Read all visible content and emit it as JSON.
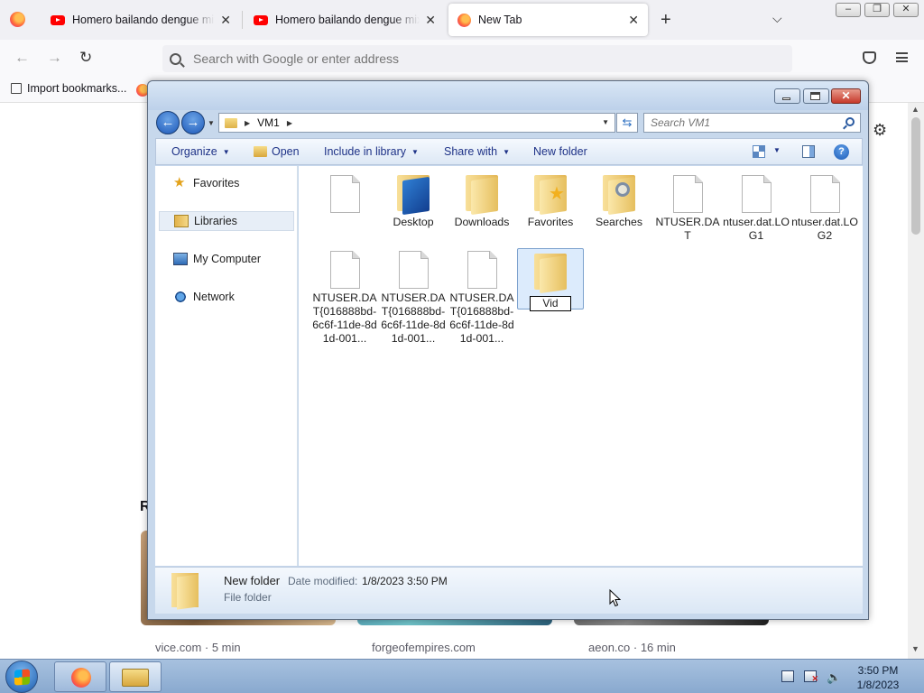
{
  "browser": {
    "tabs": [
      {
        "title": "Homero bailando dengue mix -",
        "favicon": "youtube-icon",
        "active": false
      },
      {
        "title": "Homero bailando dengue mix -",
        "favicon": "youtube-icon",
        "active": false
      },
      {
        "title": "New Tab",
        "favicon": "firefox-icon",
        "active": true
      }
    ],
    "new_tab_symbol": "+",
    "address_placeholder": "Search with Google or enter address",
    "bookmarks": [
      {
        "label": "Import bookmarks..."
      }
    ],
    "page": {
      "section_letter": "R",
      "cards": [
        {
          "label": "vice.com · 5 min"
        },
        {
          "label": "forgeofempires.com"
        },
        {
          "label": "aeon.co · 16 min"
        }
      ]
    }
  },
  "explorer": {
    "breadcrumb": [
      "VM1"
    ],
    "search_placeholder": "Search VM1",
    "commands": {
      "organize": "Organize",
      "open": "Open",
      "include": "Include in library",
      "share": "Share with",
      "new_folder": "New folder"
    },
    "nav": [
      {
        "label": "Favorites",
        "icon": "star-icon"
      },
      {
        "label": "Libraries",
        "icon": "library-icon",
        "selected": true
      },
      {
        "label": "My Computer",
        "icon": "computer-icon"
      },
      {
        "label": "Network",
        "icon": "network-icon"
      }
    ],
    "files": [
      {
        "label": "",
        "kind": "document"
      },
      {
        "label": "Desktop",
        "kind": "folder-desktop"
      },
      {
        "label": "Downloads",
        "kind": "folder"
      },
      {
        "label": "Favorites",
        "kind": "folder-star"
      },
      {
        "label": "Searches",
        "kind": "folder-search"
      },
      {
        "label": "NTUSER.DAT",
        "kind": "document"
      },
      {
        "label": "ntuser.dat.LOG1",
        "kind": "document"
      },
      {
        "label": "ntuser.dat.LOG2",
        "kind": "document"
      },
      {
        "label": "NTUSER.DAT{016888bd-6c6f-11de-8d1d-001...",
        "kind": "document"
      },
      {
        "label": "NTUSER.DAT{016888bd-6c6f-11de-8d1d-001...",
        "kind": "document"
      },
      {
        "label": "NTUSER.DAT{016888bd-6c6f-11de-8d1d-001...",
        "kind": "document"
      }
    ],
    "rename_value": "Vid",
    "details": {
      "name": "New folder",
      "modified_label": "Date modified:",
      "modified_value": "1/8/2023 3:50 PM",
      "type": "File folder"
    }
  },
  "taskbar": {
    "time": "3:50 PM",
    "date": "1/8/2023"
  }
}
